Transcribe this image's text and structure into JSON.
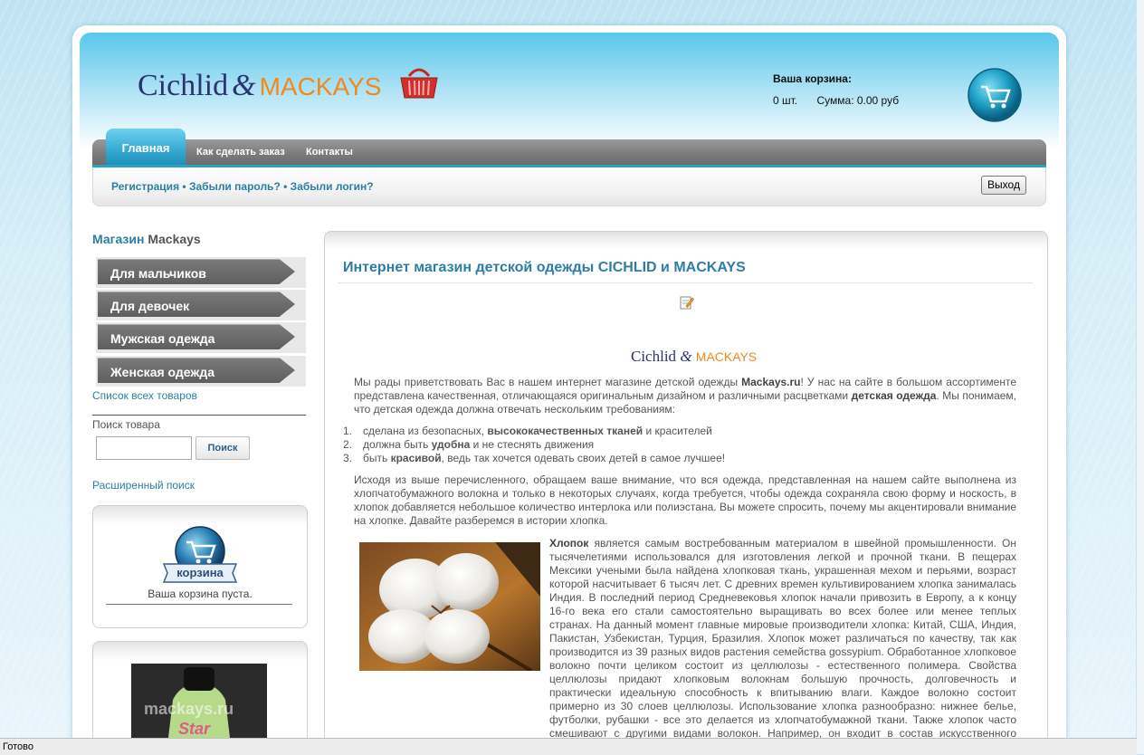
{
  "header": {
    "logo_part1": "Cichlid",
    "logo_amp": "&",
    "logo_part2": "MACKAYS",
    "cart_label": "Ваша корзина:",
    "cart_count": "0 шт.",
    "cart_sum": "Сумма: 0.00 руб"
  },
  "nav": {
    "tabs": [
      {
        "label": "Главная"
      },
      {
        "label": "Как сделать заказ"
      },
      {
        "label": "Контакты"
      }
    ]
  },
  "account": {
    "register": "Регистрация",
    "forgot_password": "Забыли пароль?",
    "forgot_login": "Забыли логин?",
    "separator": "•",
    "logout_label": "Выход"
  },
  "sidebar": {
    "title_part1": "Магазин",
    "title_part2": "Mackays",
    "categories": [
      {
        "label": "Для мальчиков"
      },
      {
        "label": "Для девочек"
      },
      {
        "label": "Мужская одежда"
      },
      {
        "label": "Женская одежда"
      }
    ],
    "all_products": "Список всех товаров",
    "search_label": "Поиск товара",
    "search_value": "",
    "search_button": "Поиск",
    "advanced_search": "Расширенный поиск",
    "cart_badge": "корзина",
    "cart_empty": "Ваша корзина пуста.",
    "product_watermark": "mackays.ru",
    "product_print": "Star"
  },
  "main": {
    "title": "Интернет магазин детской одежды CICHLID и MACKAYS",
    "intro": [
      {
        "t": "Мы рады приветствовать Вас в нашем интернет магазине детской одежды ",
        "b": false
      },
      {
        "t": "Mackays.ru",
        "b": true
      },
      {
        "t": "! У нас на сайте в большом ассортименте представлена качественная, отличающаяся оригинальным дизайном и различными расцветками ",
        "b": false
      },
      {
        "t": "детская одежда",
        "b": true
      },
      {
        "t": ". Мы понимаем, что детская одежда должна отвечать нескольким требованиям:",
        "b": false
      }
    ],
    "list": [
      [
        {
          "t": "сделана из безопасных, ",
          "b": false
        },
        {
          "t": "высококачественных тканей",
          "b": true
        },
        {
          "t": " и красителей",
          "b": false
        }
      ],
      [
        {
          "t": "должна быть ",
          "b": false
        },
        {
          "t": "удобна",
          "b": true
        },
        {
          "t": " и не стеснять движения",
          "b": false
        }
      ],
      [
        {
          "t": "быть ",
          "b": false
        },
        {
          "t": "красивой",
          "b": true
        },
        {
          "t": ", ведь так хочется одевать своих детей в самое лучшее!",
          "b": false
        }
      ]
    ],
    "para2": "Исходя из выше перечисленного, обращаем ваше внимание, что вся одежда, представленная на нашем сайте выполнена из хлопчатобумажного волокна и только в некоторых случаях, когда требуется, чтобы одежда сохраняла свою форму и носкость, в хлопок добавляется небольшое количество интерлока или полиэстана. Вы можете спросить, почему мы акцентировали внимание на хлопке. Давайте разберемся в истории хлопка.",
    "cotton_bold": "Хлопок",
    "cotton_text": " является самым востребованным материалом в швейной промышленности. Он тысячелетиями использовался для изготовления легкой и прочной ткани. В пещерах Мексики учеными была найдена хлопковая ткань, украшенная мехом и перьями, возраст которой насчитывает 6 тысяч лет. С древних времен культивированием хлопка занималась Индия. В последний период Средневековья хлопок начали привозить в Европу, а к концу 16-го века его стали самостоятельно выращивать во всех более или менее теплых странах. На данный момент главные мировые производители хлопка: Китай, США, Индия, Пакистан, Узбекистан, Турция, Бразилия. Хлопок может различаться по качеству, так как производится из 39 разных видов растения семейства gossypium. Обработанное хлопковое волокно почти целиком состоит из целлюлозы - естественного полимера. Свойства целлюлозы придают хлопковым волокнам большую прочность, долговечность и практически идеальную способность к впитыванию влаги. Каждое волокно состоит примерно из 30 слоев целлюлозы. Использование хлопка разнообразно: нижнее белье, футболки, рубашки - все это делается из хлопчатобумажной ткани. Также хлопок часто смешивают с другими видами волокон. Например, он входит в состав искусственного шелка и полиэстера. К основным свойствам хлопка также можно отнести отсутствие эластичности и склонность к быстрому"
  },
  "statusbar": {
    "text": "Готово"
  },
  "colors": {
    "accent": "#2d7ea5",
    "header_blue": "#58c7ea",
    "logo_navy": "#2b3470",
    "logo_orange": "#f08a1c"
  }
}
